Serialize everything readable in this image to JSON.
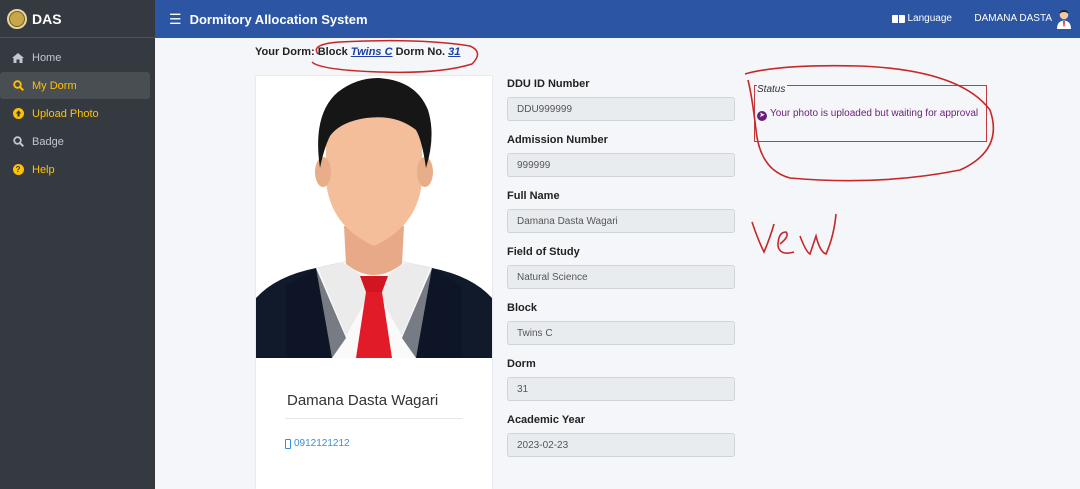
{
  "sidebar": {
    "brand": "DAS",
    "items": [
      {
        "label": "Home",
        "icon": "home-icon"
      },
      {
        "label": "My Dorm",
        "icon": "search-icon"
      },
      {
        "label": "Upload Photo",
        "icon": "upload-icon"
      },
      {
        "label": "Badge",
        "icon": "search-icon"
      },
      {
        "label": "Help",
        "icon": "question-icon"
      }
    ]
  },
  "header": {
    "title": "Dormitory Allocation System",
    "language": "Language",
    "user": "DAMANA DASTA"
  },
  "dorm_line": {
    "prefix": "Your Dorm: Block",
    "block": "Twins C",
    "middle": "Dorm No.",
    "dorm_no": "31"
  },
  "profile": {
    "name": "Damana Dasta Wagari",
    "phone": "0912121212"
  },
  "fields": [
    {
      "label": "DDU ID Number",
      "value": "DDU999999"
    },
    {
      "label": "Admission Number",
      "value": "999999"
    },
    {
      "label": "Full Name",
      "value": "Damana Dasta Wagari"
    },
    {
      "label": "Field of Study",
      "value": "Natural Science"
    },
    {
      "label": "Block",
      "value": "Twins C"
    },
    {
      "label": "Dorm",
      "value": "31"
    },
    {
      "label": "Academic Year",
      "value": "2023-02-23"
    }
  ],
  "status": {
    "legend": "Status",
    "message": "Your photo is uploaded but waiting for approval"
  },
  "annotation": {
    "handwritten": "Vew"
  },
  "colors": {
    "header": "#2c55a4",
    "sidebar": "#343a40",
    "accent": "#ffc107",
    "status_text": "#6b1f7a",
    "annotation": "#c62828"
  }
}
